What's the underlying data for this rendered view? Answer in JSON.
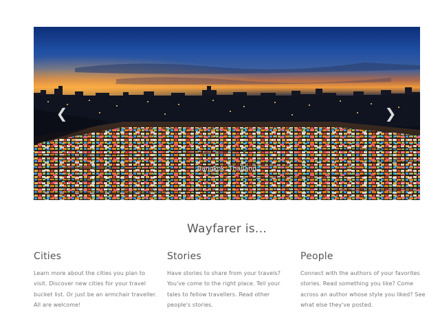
{
  "carousel": {
    "caption": "Bangkok, Thailand",
    "prev_icon": "chevron-left-icon",
    "next_icon": "chevron-right-icon",
    "prev_glyph": "❮",
    "next_glyph": "❯"
  },
  "intro": {
    "title": "Wayfarer is...",
    "features": [
      {
        "title": "Cities",
        "text": "Learn more about the cities you plan to visit. Discover new cities for your travel bucket list. Or just be an armchair traveller. All are welcome!"
      },
      {
        "title": "Stories",
        "text": "Have stories to share from your travels? You've come to the right place. Tell your tales to fellow travellers. Read other people's stories."
      },
      {
        "title": "People",
        "text": "Connect with the authors of your favorites stories. Read something you like? Come across an author whose style you liked? See what else they've posted."
      }
    ]
  },
  "colors": {
    "text": "#555555",
    "muted_text": "#777777",
    "background": "#ffffff"
  }
}
